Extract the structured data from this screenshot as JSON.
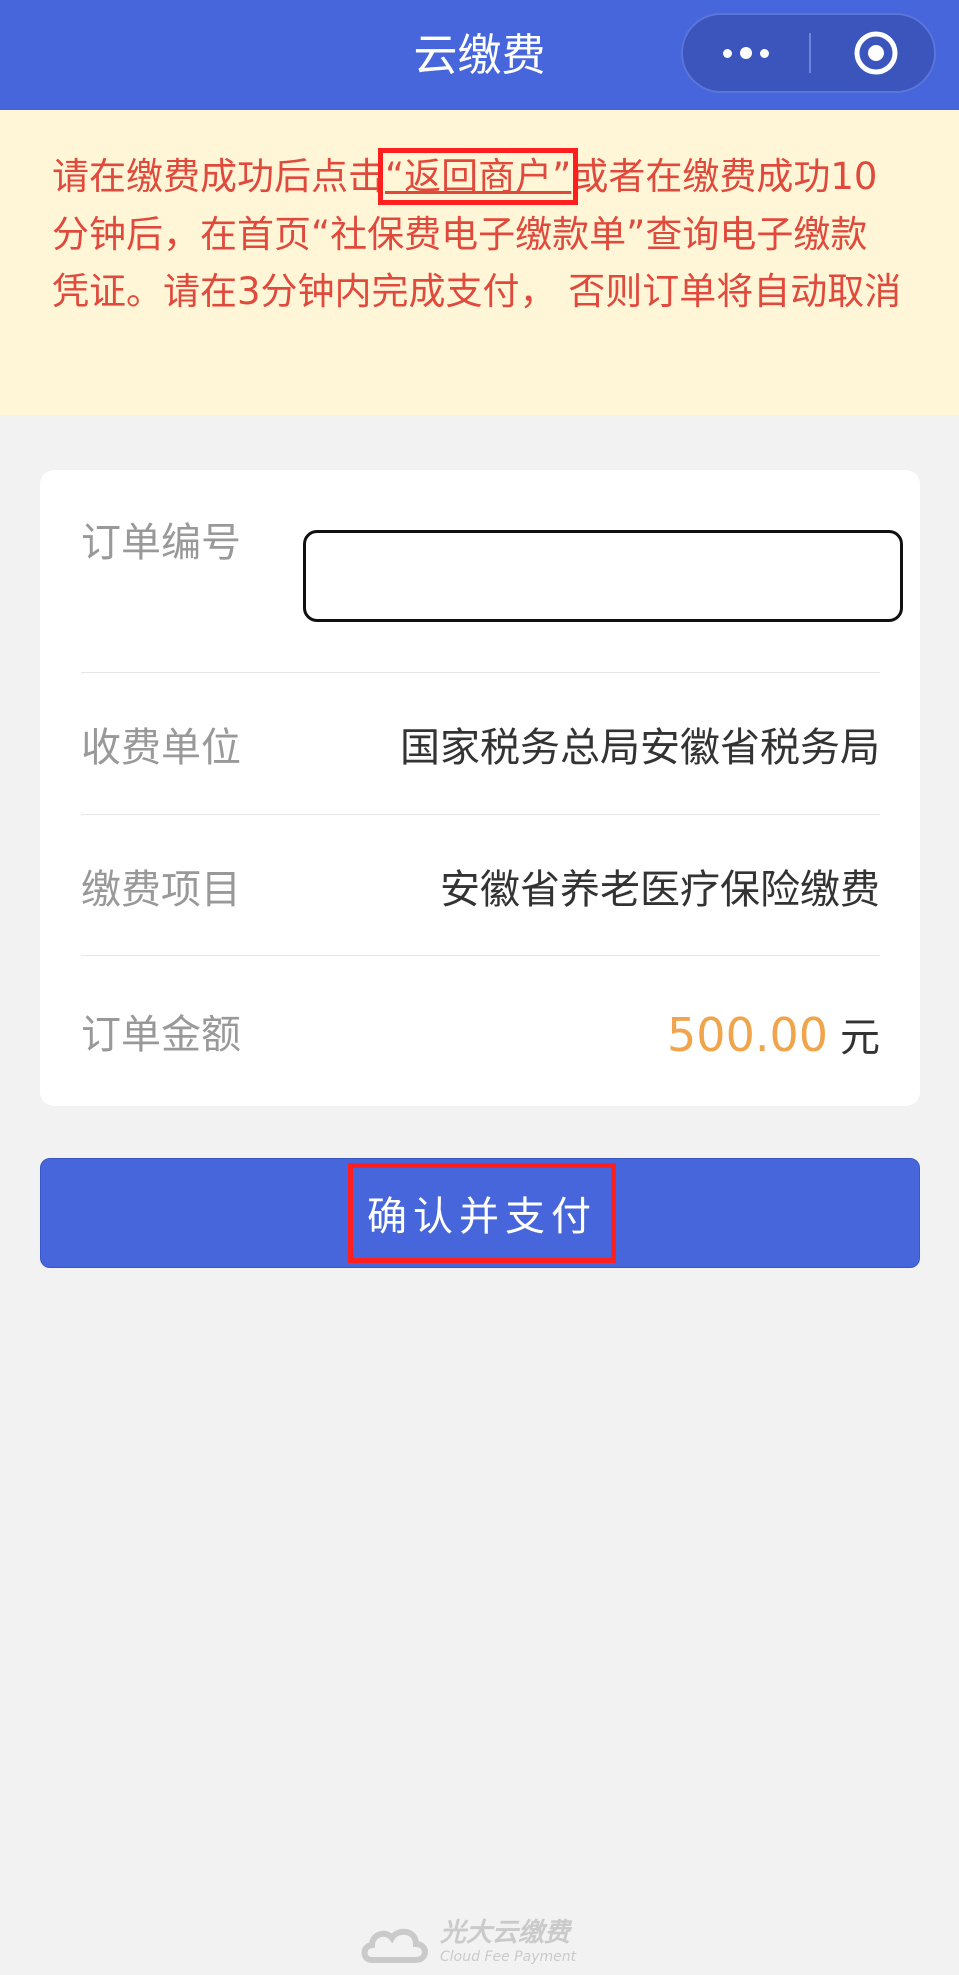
{
  "header": {
    "title": "云缴费",
    "more_icon": "more-dots-icon",
    "close_icon": "target-circle-icon"
  },
  "notice": {
    "text_before": "请在缴费成功后点击",
    "link_text": "“返回商户”",
    "text_after": "或者在缴费成功10分钟后，在首页“社保费电子缴款单”查询电子缴款凭证。请在3分钟内完成支付， 否则订单将自动取消"
  },
  "order": {
    "order_no_label": "订单编号",
    "order_no_value": "",
    "payee_label": "收费单位",
    "payee_value": "国家税务总局安徽省税务局",
    "item_label": "缴费项目",
    "item_value": "安徽省养老医疗保险缴费",
    "amount_label": "订单金额",
    "amount_value": "500.00",
    "amount_unit": "元"
  },
  "actions": {
    "confirm_label": "确认并支付"
  },
  "footer": {
    "brand_cn": "光大云缴费",
    "brand_en": "Cloud Fee Payment"
  },
  "colors": {
    "brand": "#4766db",
    "notice_bg": "#fff6d8",
    "notice_text": "#e04a3c",
    "amount": "#f0a44b",
    "highlight": "#ff1f1f"
  }
}
